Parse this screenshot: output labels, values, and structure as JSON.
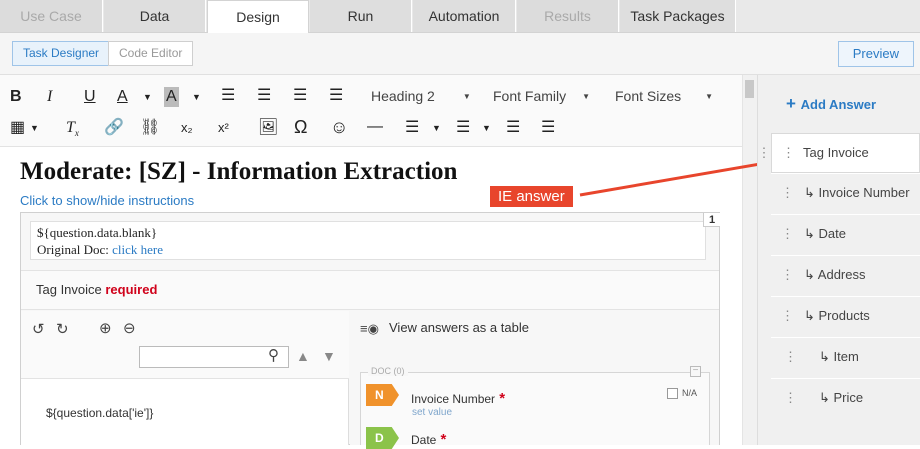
{
  "tabs": [
    {
      "label": "Use Case",
      "state": "disabled"
    },
    {
      "label": "Data",
      "state": "normal"
    },
    {
      "label": "Design",
      "state": "active"
    },
    {
      "label": "Run",
      "state": "normal"
    },
    {
      "label": "Automation",
      "state": "normal"
    },
    {
      "label": "Results",
      "state": "disabled"
    },
    {
      "label": "Task Packages",
      "state": "normal"
    }
  ],
  "subtabs": {
    "task_designer": "Task Designer",
    "code_editor": "Code Editor",
    "preview": "Preview"
  },
  "toolbar": {
    "heading": "Heading 2",
    "font_family": "Font Family",
    "font_sizes": "Font Sizes",
    "bold": "B",
    "italic": "I",
    "underline": "U",
    "font_color": "A",
    "bg_color": "A",
    "subscript": "x₂",
    "superscript": "x²",
    "omega": "Ω"
  },
  "editor": {
    "title": "Moderate: [SZ] - Information Extraction",
    "instructions_link": "Click to show/hide instructions",
    "annotation": "IE answer",
    "question_blank": "${question.data.blank}",
    "original_doc_label": "Original Doc: ",
    "original_doc_link": "click here",
    "question_number": "1",
    "tag_invoice_label": "Tag Invoice ",
    "required_label": "required",
    "template_text": "${question.data['ie']}",
    "view_table": "View answers as a table",
    "doc_label": "DOC (0)",
    "fields": [
      {
        "badge": "N",
        "label": "Invoice Number",
        "color": "#f0922b",
        "set_value": "set value",
        "na": "N/A"
      },
      {
        "badge": "D",
        "label": "Date",
        "color": "#8bc34a"
      }
    ]
  },
  "sidebar": {
    "add_answer": "Add Answer",
    "answers": [
      {
        "label": "Tag Invoice",
        "level": 0
      },
      {
        "label": "↳ Invoice Number",
        "level": 1
      },
      {
        "label": "↳ Date",
        "level": 1
      },
      {
        "label": "↳ Address",
        "level": 1
      },
      {
        "label": "↳ Products",
        "level": 1
      },
      {
        "label": "↳ Item",
        "level": 2
      },
      {
        "label": "↳ Price",
        "level": 2
      }
    ]
  },
  "colors": {
    "accent": "#2b7bc4",
    "annotation": "#e8452c",
    "required": "#d0021b"
  }
}
